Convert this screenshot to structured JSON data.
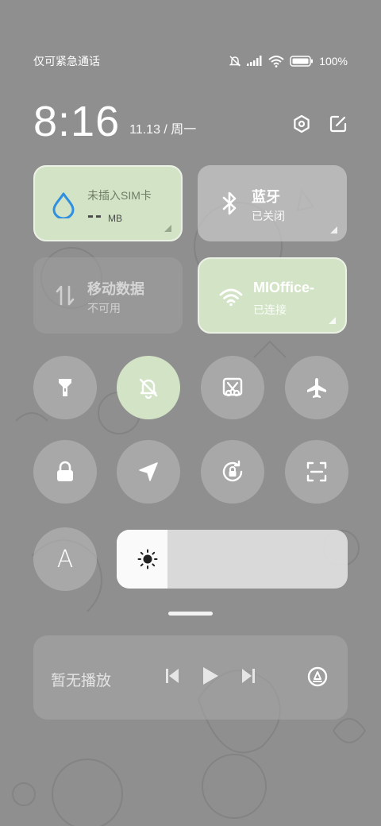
{
  "status_bar": {
    "carrier_text": "仅可紧急通话",
    "battery_text": "100%",
    "icons": [
      "mute-icon",
      "signal-icon",
      "wifi-icon",
      "battery-icon"
    ]
  },
  "header": {
    "time": "8:16",
    "date": "11.13 / 周一",
    "icons": [
      "settings-icon",
      "edit-icon"
    ]
  },
  "tiles": {
    "sim": {
      "title": "未插入SIM卡",
      "value": "--",
      "unit": "MB",
      "icon": "water-drop-icon"
    },
    "bluetooth": {
      "title": "蓝牙",
      "status": "已关闭",
      "icon": "bluetooth-icon"
    },
    "mobile_data": {
      "title": "移动数据",
      "status": "不可用",
      "icon": "mobile-data-icon"
    },
    "wifi": {
      "title": "MIOffice-",
      "status": "已连接",
      "icon": "wifi-icon"
    }
  },
  "toggles": [
    {
      "name": "flashlight",
      "icon": "flashlight-icon",
      "active": false
    },
    {
      "name": "silent",
      "icon": "bell-off-icon",
      "active": true
    },
    {
      "name": "screenshot",
      "icon": "screenshot-icon",
      "active": false
    },
    {
      "name": "airplane",
      "icon": "airplane-icon",
      "active": false
    },
    {
      "name": "lock",
      "icon": "lock-icon",
      "active": false
    },
    {
      "name": "location",
      "icon": "location-icon",
      "active": false
    },
    {
      "name": "rotation",
      "icon": "rotation-lock-icon",
      "active": false
    },
    {
      "name": "scanner",
      "icon": "scan-icon",
      "active": false
    }
  ],
  "auto_brightness": {
    "label": "A"
  },
  "brightness": {
    "level": 0.22,
    "icon": "sun-icon"
  },
  "media": {
    "label": "暂无播放",
    "icons": [
      "previous-icon",
      "play-icon",
      "next-icon",
      "cast-icon"
    ]
  },
  "colors": {
    "background": "#8f8f8f",
    "active_green": "#d3e4c6",
    "drop_blue": "#2f8fe0"
  }
}
